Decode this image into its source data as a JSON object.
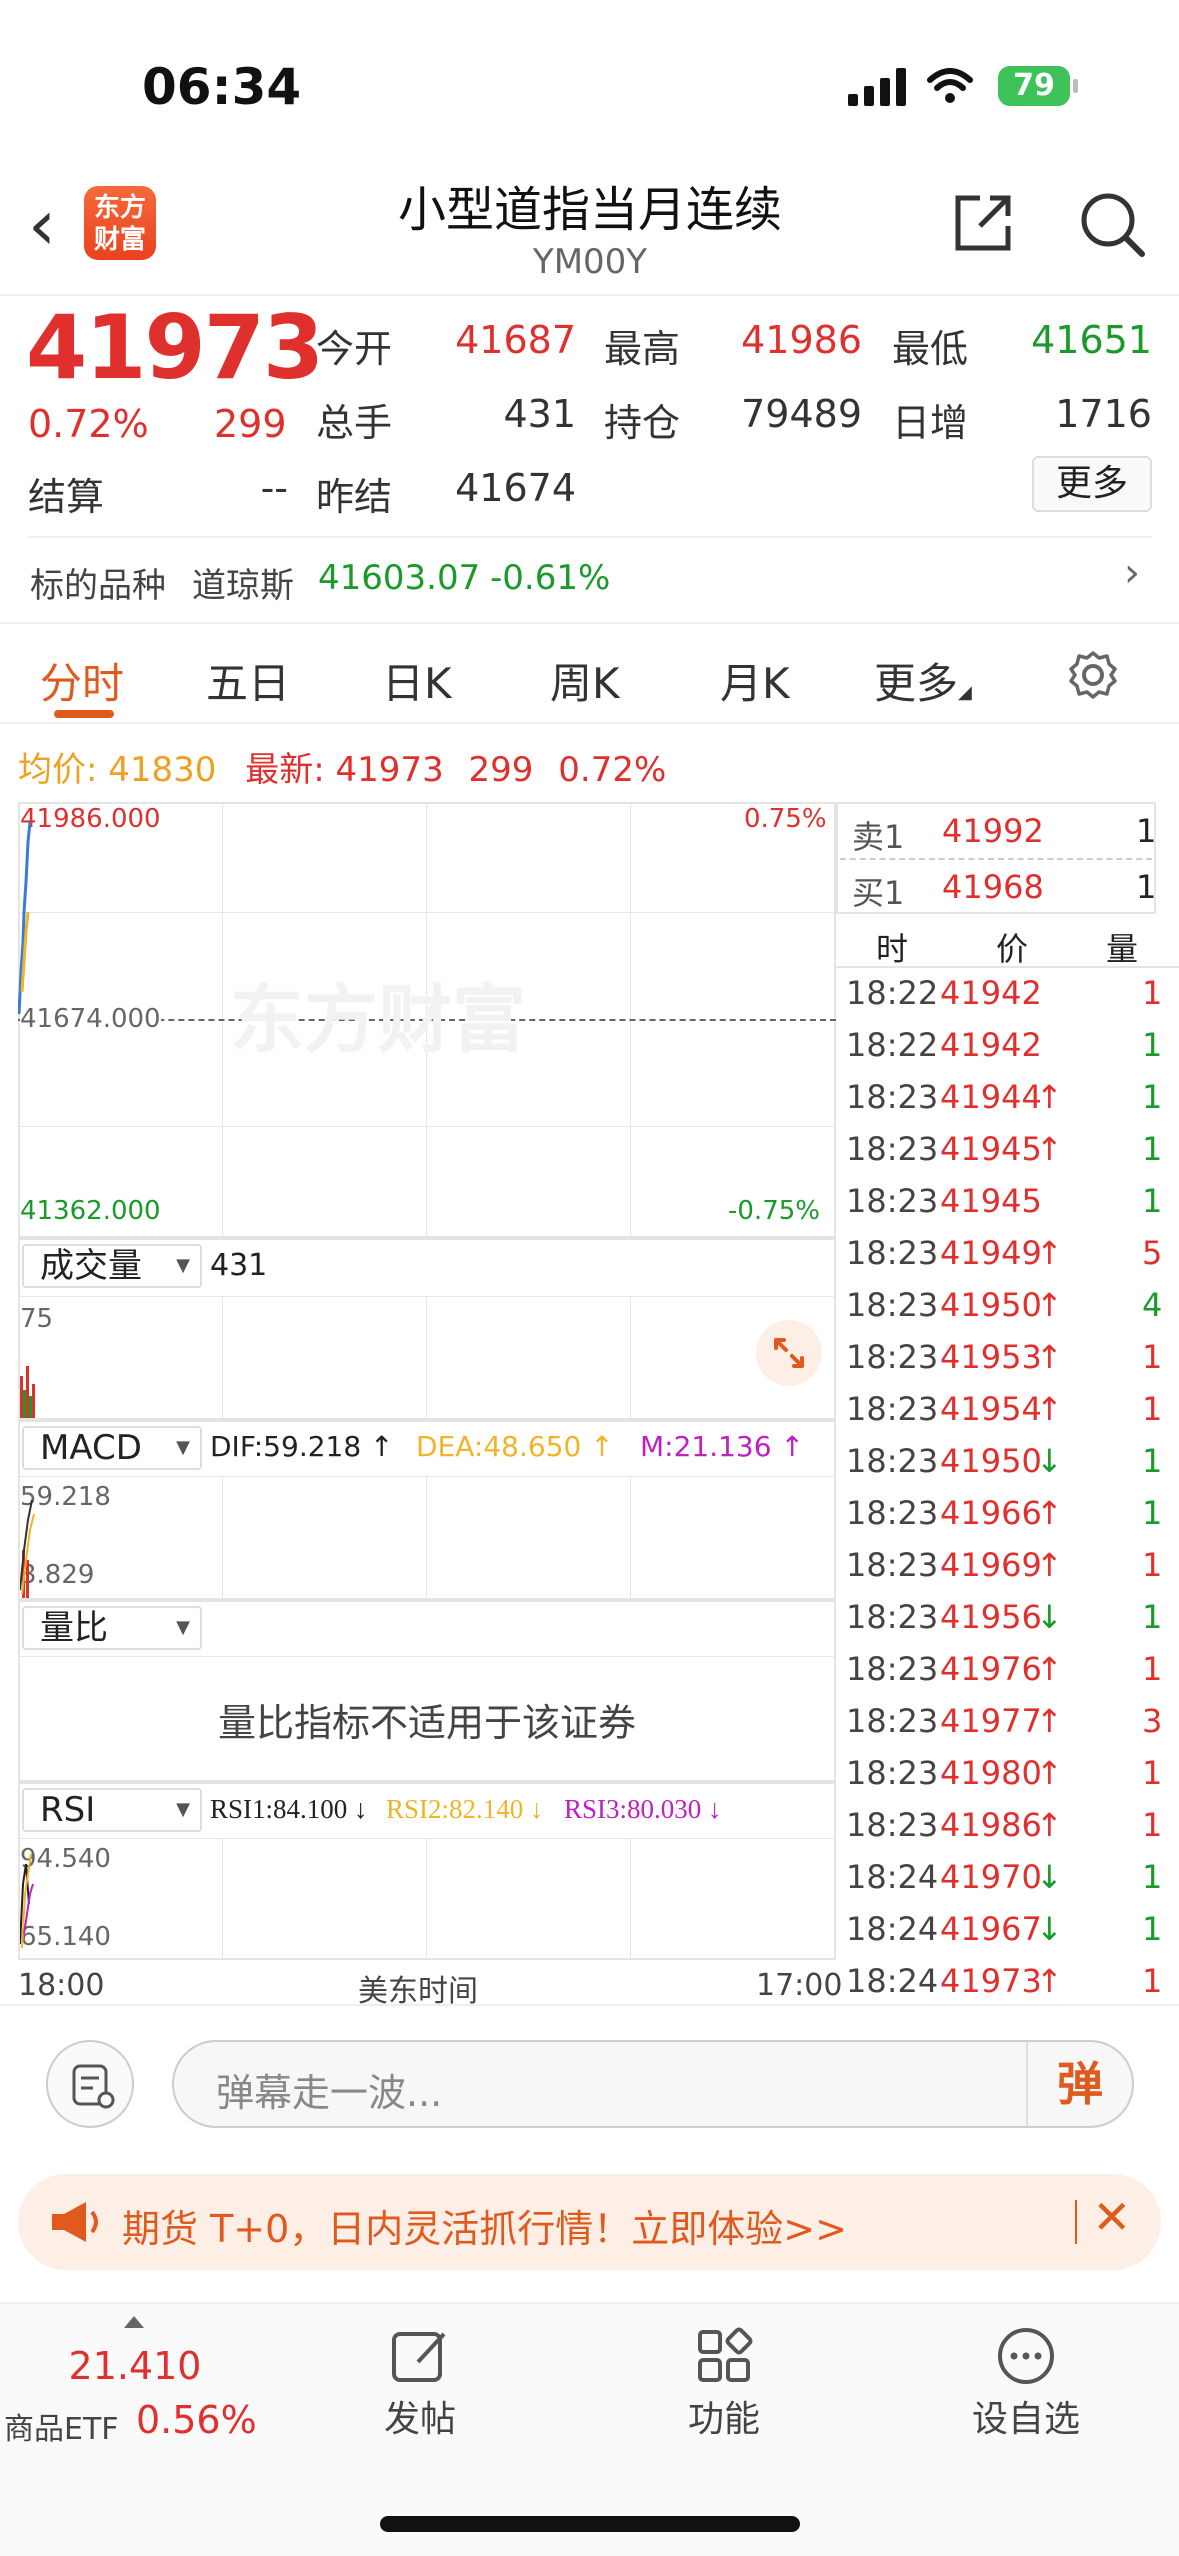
{
  "status": {
    "time": "06:34",
    "battery": "79"
  },
  "nav": {
    "logo": "东方财富",
    "title": "小型道指当月连续",
    "code": "YM00Y"
  },
  "quote": {
    "price": "41973",
    "pct": "0.72%",
    "change": "299",
    "rows": [
      [
        {
          "label": "今开",
          "value": "41687",
          "color": "red"
        },
        {
          "label": "最高",
          "value": "41986",
          "color": "red"
        },
        {
          "label": "最低",
          "value": "41651",
          "color": "green"
        }
      ],
      [
        {
          "label": "总手",
          "value": "431",
          "color": "dark"
        },
        {
          "label": "持仓",
          "value": "79489",
          "color": "dark"
        },
        {
          "label": "日增",
          "value": "1716",
          "color": "dark"
        }
      ]
    ],
    "settle_label": "结算",
    "settle_value": "--",
    "prev_label": "昨结",
    "prev_value": "41674",
    "more": "更多"
  },
  "underlying": {
    "label": "标的品种",
    "name": "道琼斯",
    "price": "41603.07",
    "pct": "-0.61%"
  },
  "tabs": [
    "分时",
    "五日",
    "日K",
    "周K",
    "月K",
    "更多"
  ],
  "info": {
    "avg_label": "均价:",
    "avg": "41830",
    "last_label": "最新:",
    "last": "41973",
    "chg": "299",
    "pct": "0.72%"
  },
  "chart": {
    "ymax": "41986.000",
    "ymid": "41674.000",
    "ymin": "41362.000",
    "pmax": "0.75%",
    "pmin": "-0.75%",
    "vol_label": "成交量",
    "vol_value": "431",
    "vol_max": "75",
    "macd_label": "MACD",
    "dif": "DIF:59.218 ↑",
    "dea": "DEA:48.650 ↑",
    "m": "M:21.136 ↑",
    "macd_top": "59.218",
    "macd_bot": "3.829",
    "lb_label": "量比",
    "lb_msg": "量比指标不适用于该证券",
    "rsi_label": "RSI",
    "rsi1": "RSI1:84.100 ↓",
    "rsi2": "RSI2:82.140 ↓",
    "rsi3": "RSI3:80.030 ↓",
    "rsi_top": "94.540",
    "rsi_bot": "65.140",
    "x_start": "18:00",
    "x_mid": "美东时间",
    "x_end": "17:00",
    "watermark": "东方财富",
    "colors": {
      "price": "#3a7bd5",
      "avg": "#f0b429"
    }
  },
  "book": {
    "sell": {
      "label": "卖1",
      "price": "41992",
      "qty": "1"
    },
    "buy": {
      "label": "买1",
      "price": "41968",
      "qty": "1"
    },
    "headers": [
      "时",
      "价",
      "量"
    ],
    "trades": [
      {
        "t": "18:22",
        "p": "41942",
        "a": "",
        "q": "1",
        "qc": "red"
      },
      {
        "t": "18:22",
        "p": "41942",
        "a": "",
        "q": "1",
        "qc": "green"
      },
      {
        "t": "18:23",
        "p": "41944",
        "a": "↑",
        "q": "1",
        "qc": "green"
      },
      {
        "t": "18:23",
        "p": "41945",
        "a": "↑",
        "q": "1",
        "qc": "green"
      },
      {
        "t": "18:23",
        "p": "41945",
        "a": "",
        "q": "1",
        "qc": "green"
      },
      {
        "t": "18:23",
        "p": "41949",
        "a": "↑",
        "q": "5",
        "qc": "red"
      },
      {
        "t": "18:23",
        "p": "41950",
        "a": "↑",
        "q": "4",
        "qc": "green"
      },
      {
        "t": "18:23",
        "p": "41953",
        "a": "↑",
        "q": "1",
        "qc": "red"
      },
      {
        "t": "18:23",
        "p": "41954",
        "a": "↑",
        "q": "1",
        "qc": "red"
      },
      {
        "t": "18:23",
        "p": "41950",
        "a": "↓",
        "q": "1",
        "qc": "green"
      },
      {
        "t": "18:23",
        "p": "41966",
        "a": "↑",
        "q": "1",
        "qc": "green"
      },
      {
        "t": "18:23",
        "p": "41969",
        "a": "↑",
        "q": "1",
        "qc": "red"
      },
      {
        "t": "18:23",
        "p": "41956",
        "a": "↓",
        "q": "1",
        "qc": "green"
      },
      {
        "t": "18:23",
        "p": "41976",
        "a": "↑",
        "q": "1",
        "qc": "red"
      },
      {
        "t": "18:23",
        "p": "41977",
        "a": "↑",
        "q": "3",
        "qc": "red"
      },
      {
        "t": "18:23",
        "p": "41980",
        "a": "↑",
        "q": "1",
        "qc": "red"
      },
      {
        "t": "18:23",
        "p": "41986",
        "a": "↑",
        "q": "1",
        "qc": "red"
      },
      {
        "t": "18:24",
        "p": "41970",
        "a": "↓",
        "q": "1",
        "qc": "green"
      },
      {
        "t": "18:24",
        "p": "41967",
        "a": "↓",
        "q": "1",
        "qc": "green"
      },
      {
        "t": "18:24",
        "p": "41973",
        "a": "↑",
        "q": "1",
        "qc": "red"
      }
    ]
  },
  "danmu": {
    "placeholder": "弹幕走一波...",
    "button": "弹"
  },
  "banner": {
    "text": "期货 T+0，日内灵活抓行情！立即体验>>",
    "close": "✕"
  },
  "tabbar": {
    "etf_value": "21.410",
    "etf_label": "商品ETF",
    "etf_pct": "0.56%",
    "post": "发帖",
    "func": "功能",
    "watch": "设自选"
  }
}
